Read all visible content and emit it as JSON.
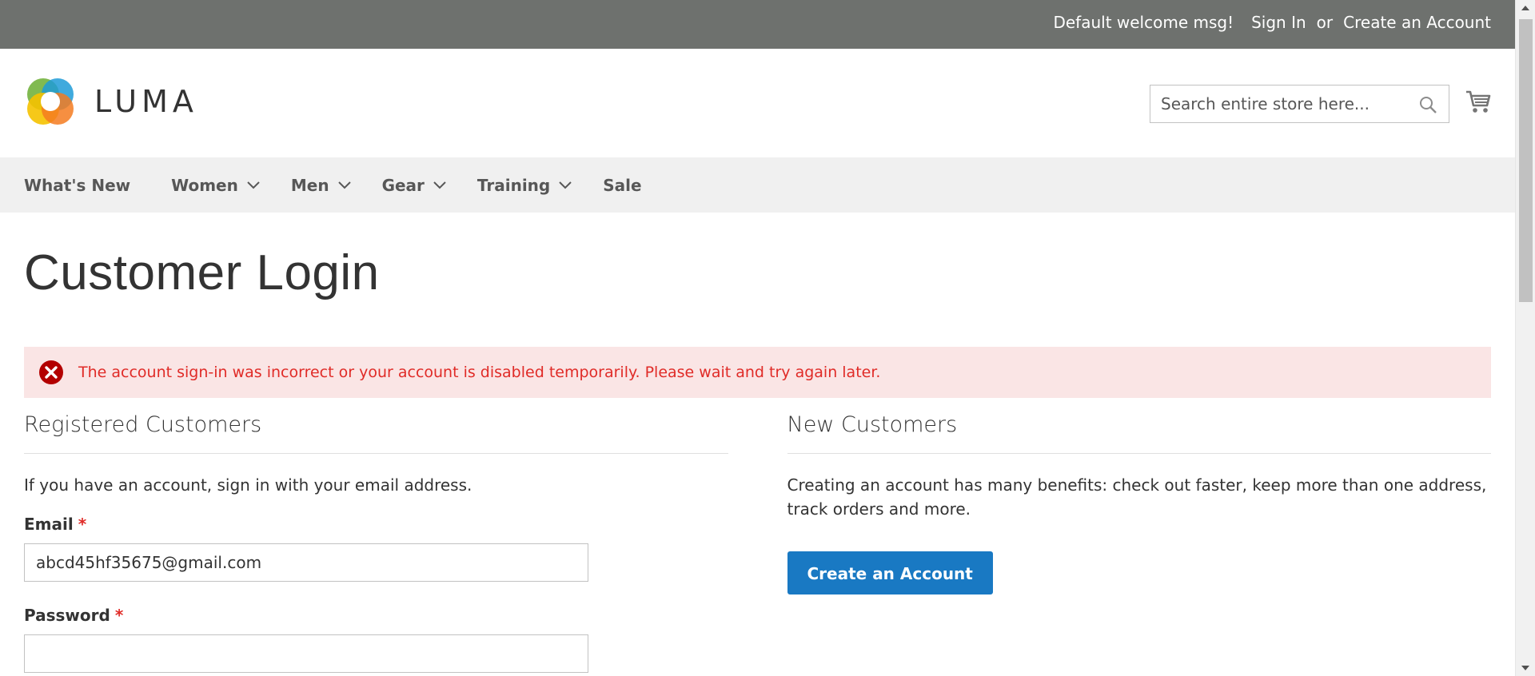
{
  "top_panel": {
    "welcome": "Default welcome msg!",
    "sign_in": "Sign In",
    "or": "or",
    "create_account": "Create an Account"
  },
  "header": {
    "logo_text": "LUMA",
    "search_placeholder": "Search entire store here...",
    "search_value": ""
  },
  "nav": {
    "items": [
      {
        "label": "What's New",
        "has_dropdown": false
      },
      {
        "label": "Women",
        "has_dropdown": true
      },
      {
        "label": "Men",
        "has_dropdown": true
      },
      {
        "label": "Gear",
        "has_dropdown": true
      },
      {
        "label": "Training",
        "has_dropdown": true
      },
      {
        "label": "Sale",
        "has_dropdown": false
      }
    ]
  },
  "main": {
    "title": "Customer Login",
    "error_message": "The account sign-in was incorrect or your account is disabled temporarily. Please wait and try again later.",
    "registered": {
      "title": "Registered Customers",
      "text": "If you have an account, sign in with your email address.",
      "email_label": "Email",
      "email_value": "abcd45hf35675@gmail.com",
      "password_label": "Password",
      "password_value": "",
      "required_mark": "*"
    },
    "new_customers": {
      "title": "New Customers",
      "text": "Creating an account has many benefits: check out faster, keep more than one address, track orders and more.",
      "button": "Create an Account"
    }
  },
  "colors": {
    "top_panel_bg": "#6e716e",
    "nav_bg": "#f0f0f0",
    "error_bg": "#fae5e5",
    "error_text": "#e02b27",
    "primary_button": "#1979c3"
  }
}
